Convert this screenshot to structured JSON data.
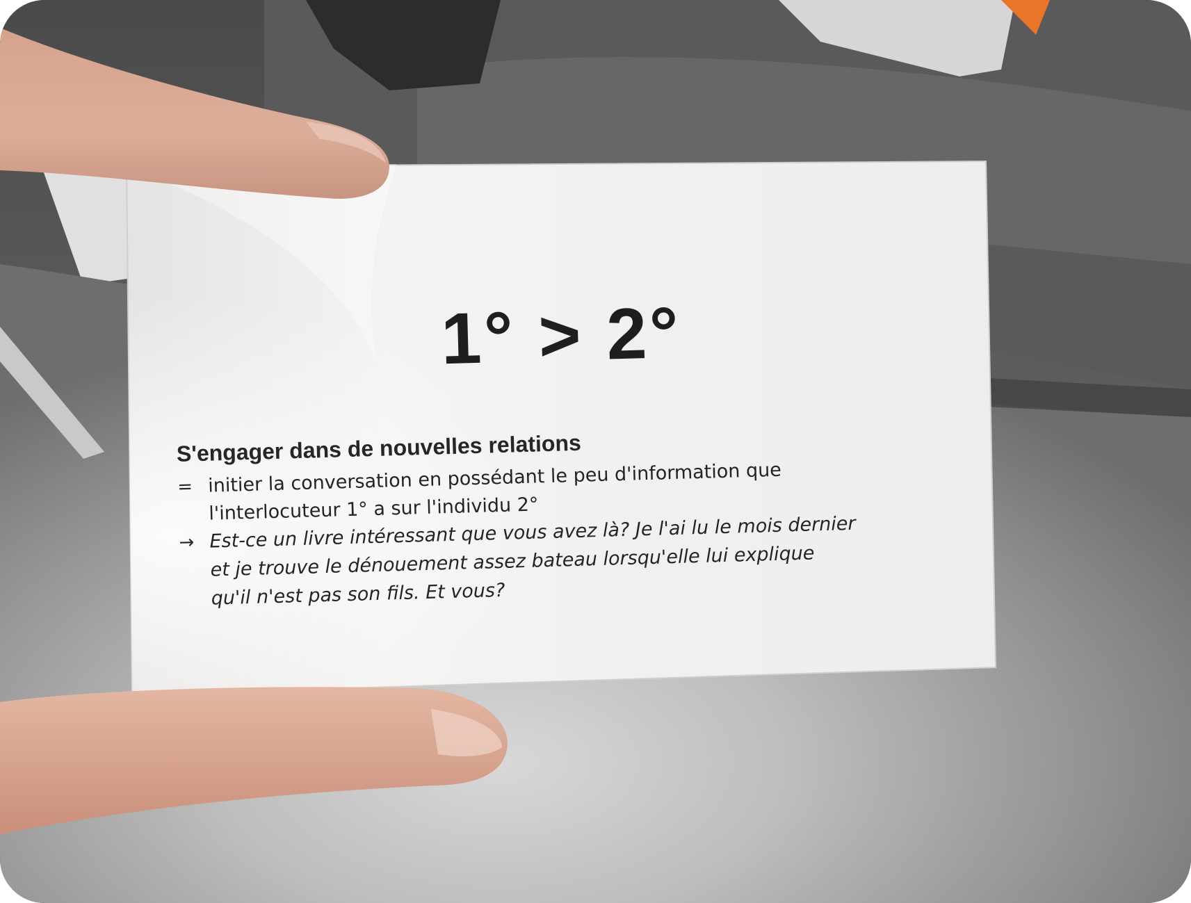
{
  "card": {
    "title": "1° > 2°",
    "heading": "S'engager dans de nouvelles relations",
    "bullet_marker": "=",
    "bullet_line_1": "initier la conversation en possédant le peu d'information que",
    "bullet_line_2": "l'interlocuteur 1° a sur l'individu 2°",
    "arrow_marker": "→",
    "example_line_1": "Est-ce un livre intéressant que vous avez là? Je l'ai lu le mois dernier",
    "example_line_2": "et je trouve le dénouement assez bateau lorsqu'elle lui explique",
    "example_line_3": "qu'il n'est pas son fils. Et vous?"
  },
  "colors": {
    "card": "#f2f2f0",
    "skin": "#d9a994",
    "floor": "#9b9b9b",
    "background_dark": "#3a3a3a"
  }
}
